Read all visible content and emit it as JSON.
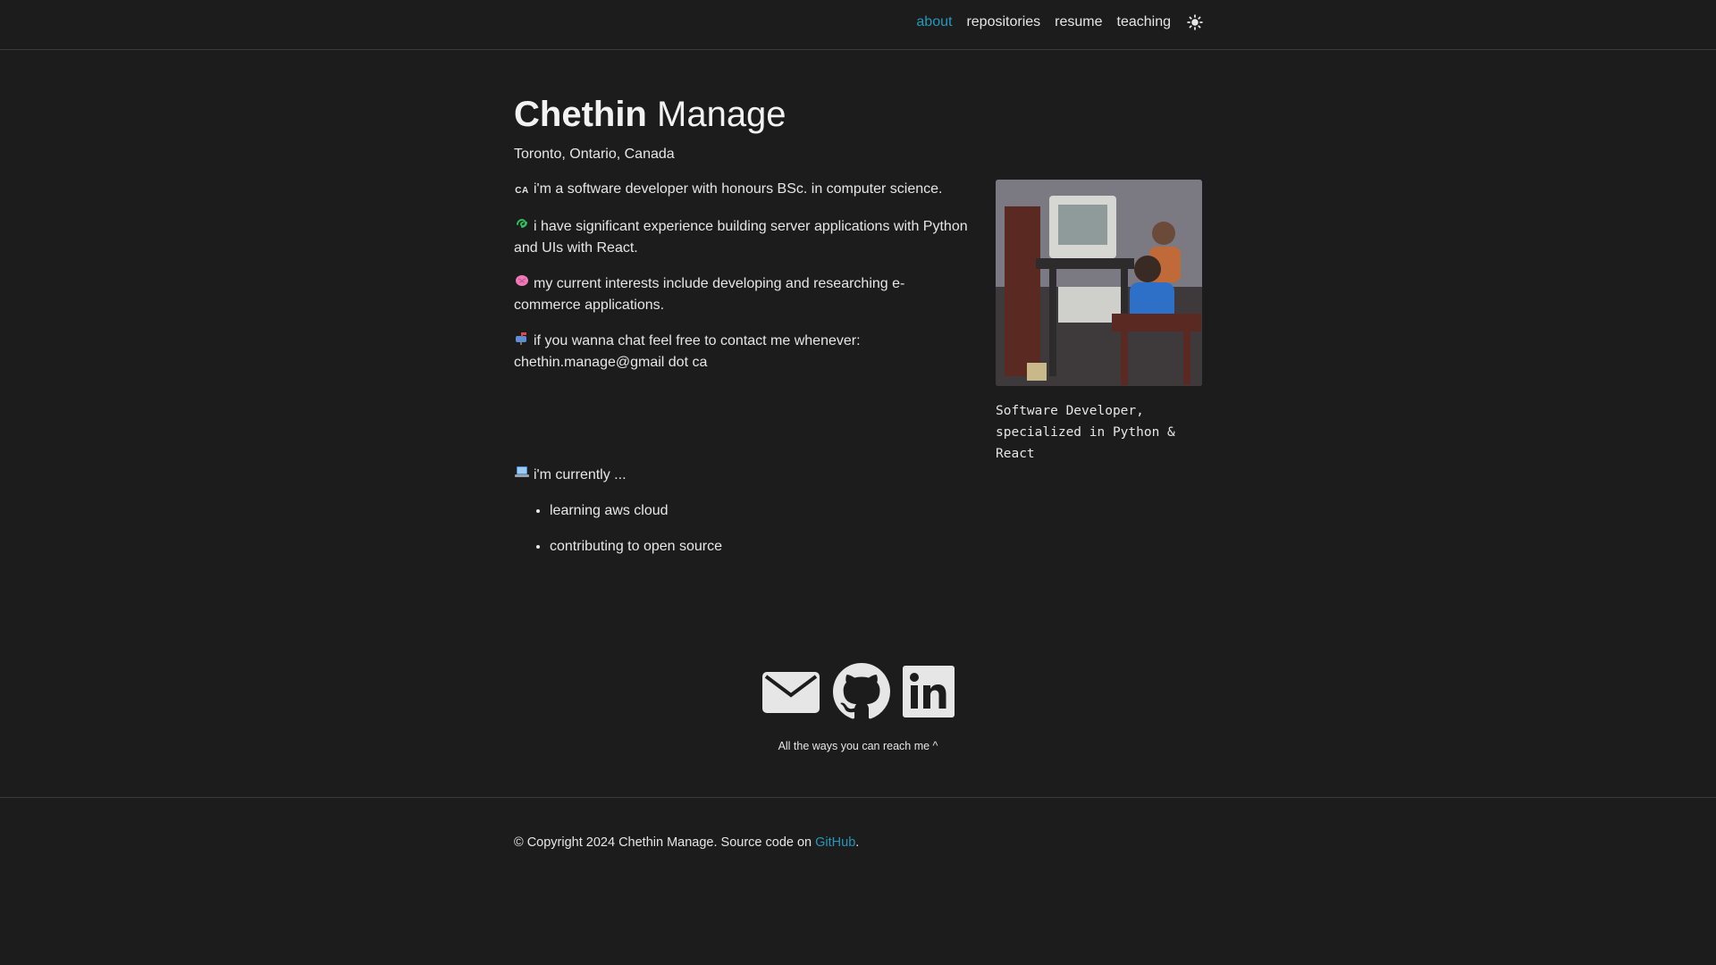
{
  "nav": {
    "items": [
      {
        "label": "about",
        "active": true
      },
      {
        "label": "repositories",
        "active": false
      },
      {
        "label": "resume",
        "active": false
      },
      {
        "label": "teaching",
        "active": false
      }
    ],
    "theme_icon": "sun-icon",
    "accent_color": "#2698ba"
  },
  "header": {
    "first_name": "Chethin",
    "last_name": "Manage",
    "location": "Toronto, Ontario, Canada"
  },
  "profile": {
    "caption": "Software Developer, specialized in Python & React"
  },
  "bio": [
    {
      "icon": "ca-flag-icon",
      "badge": "CA",
      "text": "i'm a software developer with honours BSc. in computer science."
    },
    {
      "icon": "loop-icon",
      "text": "i have significant experience building server applications with Python and UIs with React."
    },
    {
      "icon": "brain-icon",
      "text": "my current interests include developing and researching e-commerce applications."
    },
    {
      "icon": "mailbox-icon",
      "text": "if you wanna chat feel free to contact me whenever: chethin.manage@gmail dot ca"
    }
  ],
  "currently": {
    "icon": "laptop-icon",
    "heading": "i'm currently ...",
    "items": [
      "learning aws cloud",
      "contributing to open source"
    ]
  },
  "social": {
    "icons": [
      "envelope-icon",
      "github-icon",
      "linkedin-icon"
    ],
    "caption": "All the ways you can reach me ^"
  },
  "footer": {
    "text_before": "© Copyright 2024 Chethin Manage. Source code on ",
    "link_label": "GitHub",
    "text_after": "."
  }
}
